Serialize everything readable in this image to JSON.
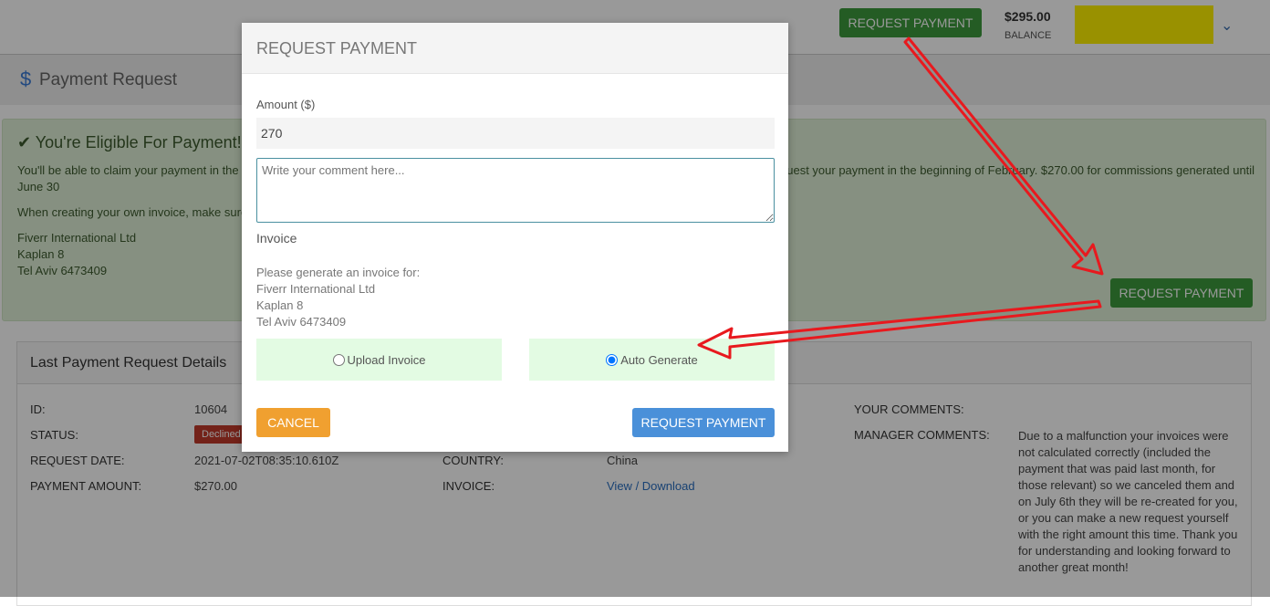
{
  "header": {
    "request_payment": "REQUEST PAYMENT",
    "balance_amount": "$295.00",
    "balance_label": "BALANCE",
    "user_menu_icon": "chevron-down-icon",
    "redaction_color": "#fff200"
  },
  "page": {
    "title_icon": "dollar-icon",
    "title": "Payment Request"
  },
  "alert": {
    "icon": "check-icon",
    "heading": "You're Eligible For Payment!",
    "line1_left": "You'll be able to claim your payment in the b",
    "line1_right": "quest your payment in the beginning of February. $270.00 for commissions generated until",
    "line2": "June 30",
    "line3": "When creating your own invoice, make sure",
    "address": [
      "Fiverr International Ltd",
      "Kaplan 8",
      "Tel Aviv 6473409"
    ],
    "request_payment": "REQUEST PAYMENT"
  },
  "details": {
    "title": "Last Payment Request Details",
    "rows": [
      {
        "label": "ID:",
        "value": "10604"
      },
      {
        "label": "STATUS:",
        "value": "Declined"
      },
      {
        "label": "REQUEST DATE:",
        "value": "2021-07-02T08:35:10.610Z"
      },
      {
        "label": "PAYMENT AMOUNT:",
        "value": "$270.00"
      }
    ],
    "country_label": "COUNTRY:",
    "country_value": "China",
    "invoice_label": "INVOICE:",
    "invoice_view": "View",
    "invoice_sep": " / ",
    "invoice_download": "Download",
    "your_comments_label": "YOUR COMMENTS:",
    "manager_comments_label": "MANAGER COMMENTS:",
    "manager_comments": "Due to a malfunction your invoices were not calculated correctly (included the payment that was paid last month, for those relevant) so we canceled them and on July 6th they will be re-created for you, or you can make a new request yourself with the right amount this time. Thank you for understanding and looking forward to another great month!"
  },
  "modal": {
    "title": "REQUEST PAYMENT",
    "amount_label": "Amount ($)",
    "amount_value": "270",
    "comment_placeholder": "Write your comment here...",
    "invoice_heading": "Invoice",
    "invoice_note": [
      "Please generate an invoice for:",
      "Fiverr International Ltd",
      "Kaplan 8",
      "Tel Aviv 6473409"
    ],
    "upload_label": "Upload Invoice",
    "auto_label": "Auto Generate",
    "selected_option": "Auto Generate",
    "cancel": "CANCEL",
    "submit": "REQUEST PAYMENT"
  },
  "colors": {
    "green": "#3c9a3c",
    "cancel": "#f0a030",
    "submit": "#4a90d9",
    "declined": "#c0392b",
    "arrow": "#e8191e"
  }
}
